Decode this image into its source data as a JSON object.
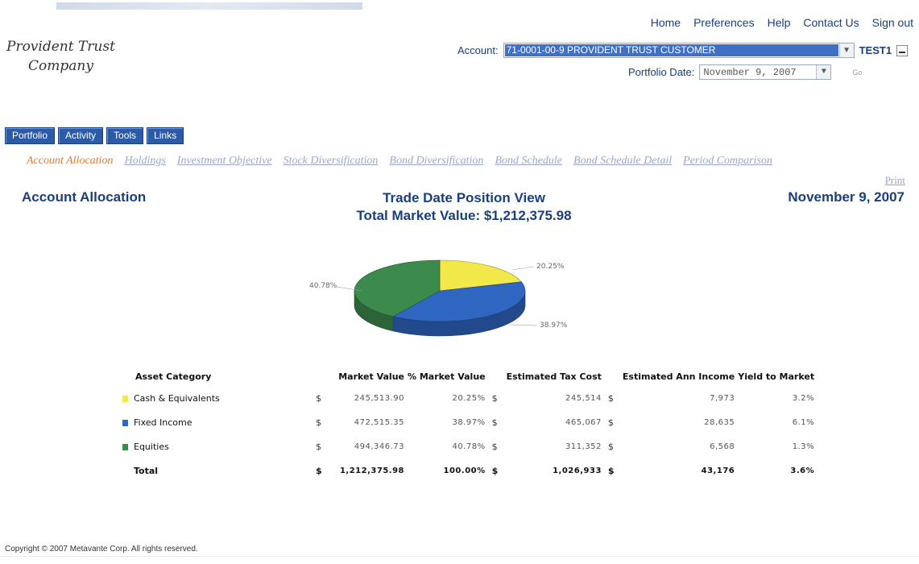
{
  "brand": {
    "line1": "Provident Trust",
    "line2": "Company"
  },
  "topnav": [
    "Home",
    "Preferences",
    "Help",
    "Contact Us",
    "Sign out"
  ],
  "account": {
    "label": "Account:",
    "value": "71-0001-00-9 PROVIDENT TRUST CUSTOMER",
    "user": "TEST1"
  },
  "portfolio_date": {
    "label": "Portfolio Date:",
    "value": "November 9, 2007",
    "go": "Go"
  },
  "tabs": [
    "Portfolio",
    "Activity",
    "Tools",
    "Links"
  ],
  "subnav": [
    "Account Allocation",
    "Holdings",
    "Investment Objective",
    "Stock Diversification",
    "Bond Diversification",
    "Bond Schedule",
    "Bond Schedule Detail",
    "Period Comparison"
  ],
  "print": "Print",
  "page": {
    "section_title": "Account Allocation",
    "view_title": "Trade Date Position View",
    "total_mv": "Total Market Value: $1,212,375.98",
    "date": "November 9, 2007"
  },
  "chart_data": {
    "type": "pie",
    "labels": [
      "Cash & Equivalents",
      "Fixed Income",
      "Equities"
    ],
    "values": [
      20.25,
      38.97,
      40.78
    ],
    "value_labels": [
      "20.25%",
      "38.97%",
      "40.78%"
    ],
    "colors": [
      "#f2e84a",
      "#2f66c2",
      "#3d8a4d"
    ]
  },
  "table": {
    "headers": [
      "Asset Category",
      "Market Value",
      "% Market Value",
      "Estimated Tax Cost",
      "Estimated Ann Income",
      "Yield to Market"
    ],
    "currency": "$",
    "rows": [
      {
        "name": "Cash & Equivalents",
        "color": "#f2e84a",
        "mv": "245,513.90",
        "pct": "20.25%",
        "cost": "245,514",
        "income": "7,973",
        "yield": "3.2%"
      },
      {
        "name": "Fixed Income",
        "color": "#2f66c2",
        "mv": "472,515.35",
        "pct": "38.97%",
        "cost": "465,067",
        "income": "28,635",
        "yield": "6.1%"
      },
      {
        "name": "Equities",
        "color": "#3d8a4d",
        "mv": "494,346.73",
        "pct": "40.78%",
        "cost": "311,352",
        "income": "6,568",
        "yield": "1.3%"
      }
    ],
    "total": {
      "name": "Total",
      "mv": "1,212,375.98",
      "pct": "100.00%",
      "cost": "1,026,933",
      "income": "43,176",
      "yield": "3.6%"
    }
  },
  "footer": "Copyright © 2007 Metavante Corp. All rights reserved."
}
